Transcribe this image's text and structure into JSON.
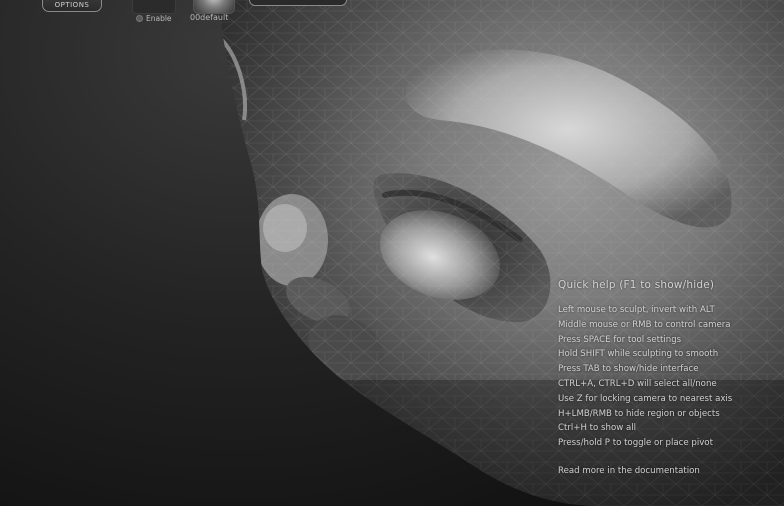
{
  "toolbar": {
    "options_label": "OPTIONS",
    "enable_label": "Enable",
    "matcap_label": "00default"
  },
  "quick_help": {
    "title": "Quick help (F1 to show/hide)",
    "lines": [
      "Left mouse to sculpt, invert with ALT",
      "Middle mouse or RMB to control camera",
      "Press SPACE for tool settings",
      "Hold SHIFT while sculpting to smooth",
      "Press TAB to show/hide interface",
      "CTRL+A, CTRL+D will select all/none",
      "Use Z for locking camera to nearest axis",
      "H+LMB/RMB to hide region or objects",
      "Ctrl+H to show all",
      "Press/hold P to toggle or place pivot"
    ],
    "doc_link": "Read more in the documentation"
  },
  "colors": {
    "background": "#1a1a1a",
    "mesh": "#8c8c8c",
    "text": "#d2d2d2"
  }
}
